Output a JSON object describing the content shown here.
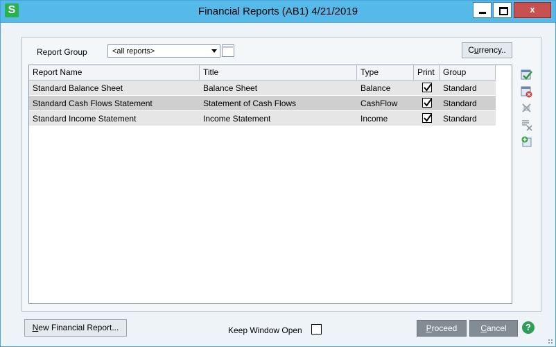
{
  "window": {
    "title": "Financial Reports (AB1) 4/21/2019",
    "logo_letter": "S",
    "close_glyph": "x"
  },
  "filters": {
    "report_group_label": "Report Group",
    "report_group_value": "<all reports>",
    "currency_button": {
      "accel": "u",
      "pre": "C",
      "post": "rrency.."
    }
  },
  "grid": {
    "columns": [
      "Report Name",
      "Title",
      "Type",
      "Print",
      "Group"
    ],
    "rows": [
      {
        "name": "Standard Balance Sheet",
        "title": "Balance Sheet",
        "type": "Balance",
        "print": true,
        "group": "Standard"
      },
      {
        "name": "Standard Cash Flows Statement",
        "title": "Statement of Cash Flows",
        "type": "CashFlow",
        "print": true,
        "group": "Standard"
      },
      {
        "name": "Standard Income Statement",
        "title": "Income Statement",
        "type": "Income",
        "print": true,
        "group": "Standard"
      }
    ]
  },
  "side_toolbar": {
    "icons": [
      "select-all-icon",
      "clear-all-icon",
      "delete-icon",
      "delete-line-icon",
      "add-report-icon"
    ]
  },
  "footer": {
    "new_report_button": {
      "accel": "N",
      "rest": "ew Financial Report..."
    },
    "keep_window_open_label": "Keep Window Open",
    "keep_window_open_checked": false,
    "proceed_button": {
      "accel": "P",
      "rest": "roceed"
    },
    "cancel_button": {
      "accel": "C",
      "rest": "ancel"
    },
    "help_glyph": "?"
  },
  "colors": {
    "titlebar": "#55b9ea",
    "row_light": "#e6e6e6",
    "row_dark": "#cfcfcf",
    "action_button": "#838b93",
    "help": "#2e9e57"
  }
}
